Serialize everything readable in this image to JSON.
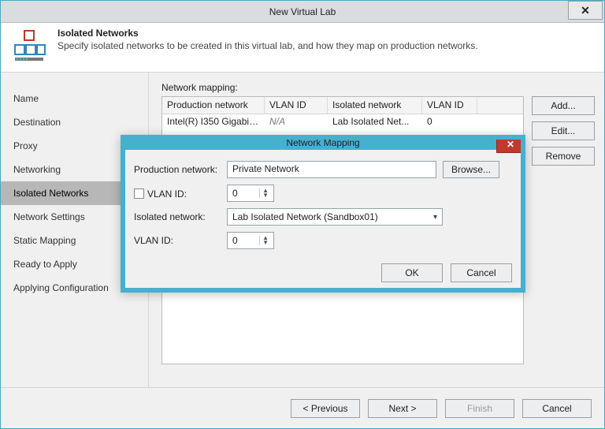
{
  "window": {
    "title": "New Virtual Lab"
  },
  "header": {
    "heading": "Isolated Networks",
    "subheading": "Specify isolated networks to be created in this virtual lab, and how they map on production networks."
  },
  "sidebar": {
    "items": [
      {
        "label": "Name",
        "selected": false
      },
      {
        "label": "Destination",
        "selected": false
      },
      {
        "label": "Proxy",
        "selected": false
      },
      {
        "label": "Networking",
        "selected": false
      },
      {
        "label": "Isolated Networks",
        "selected": true
      },
      {
        "label": "Network Settings",
        "selected": false
      },
      {
        "label": "Static Mapping",
        "selected": false
      },
      {
        "label": "Ready to Apply",
        "selected": false
      },
      {
        "label": "Applying Configuration",
        "selected": false
      }
    ]
  },
  "main": {
    "mapping_label": "Network mapping:",
    "columns": [
      "Production network",
      "VLAN ID",
      "Isolated network",
      "VLAN ID"
    ],
    "rows": [
      {
        "prod": "Intel(R) I350 Gigabit ...",
        "vlan1": "N/A",
        "iso": "Lab Isolated Net...",
        "vlan2": "0"
      }
    ],
    "buttons": {
      "add": "Add...",
      "edit": "Edit...",
      "remove": "Remove"
    }
  },
  "footer": {
    "previous": "< Previous",
    "next": "Next >",
    "finish": "Finish",
    "cancel": "Cancel"
  },
  "modal": {
    "title": "Network Mapping",
    "labels": {
      "prod": "Production network:",
      "vlan1": "VLAN ID:",
      "iso": "Isolated network:",
      "vlan2": "VLAN ID:",
      "browse": "Browse...",
      "ok": "OK",
      "cancel": "Cancel"
    },
    "values": {
      "prod": "Private Network",
      "vlan1": "0",
      "iso": "Lab Isolated Network (Sandbox01)",
      "vlan2": "0",
      "vlan1_checked": false
    }
  }
}
